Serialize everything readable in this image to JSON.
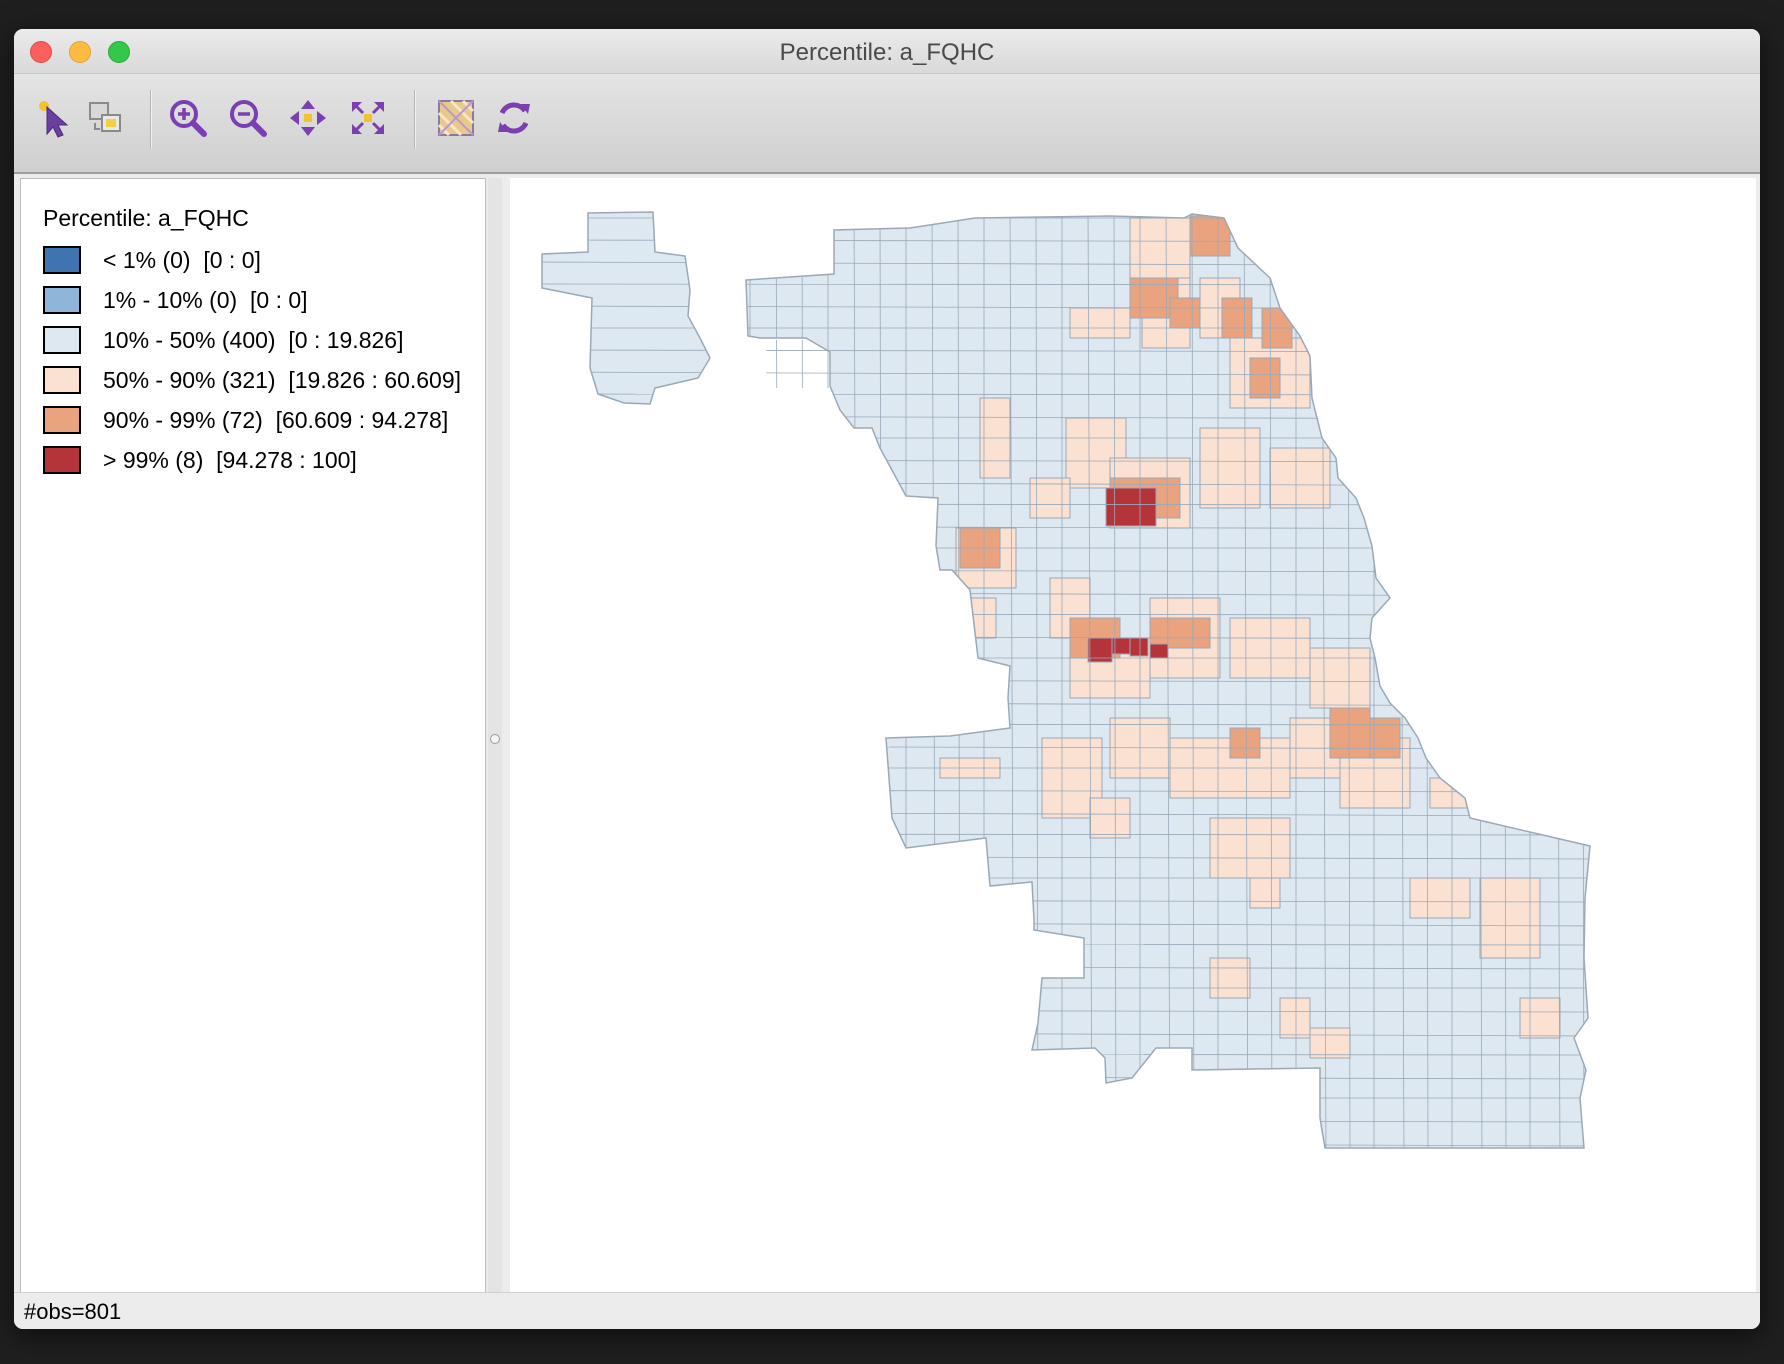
{
  "window": {
    "title": "Percentile: a_FQHC"
  },
  "toolbar": {
    "tools": [
      {
        "name": "select-icon"
      },
      {
        "name": "copy-selection-icon"
      },
      {
        "name": "zoom-in-icon"
      },
      {
        "name": "zoom-out-icon"
      },
      {
        "name": "pan-icon"
      },
      {
        "name": "fit-to-window-icon"
      },
      {
        "name": "map-layers-icon"
      },
      {
        "name": "refresh-icon"
      }
    ]
  },
  "legend": {
    "title": "Percentile: a_FQHC",
    "items": [
      {
        "label": "< 1% (0)  [0 : 0]",
        "color": "#3f74b1"
      },
      {
        "label": "1% - 10% (0)  [0 : 0]",
        "color": "#8fb6d9"
      },
      {
        "label": "10% - 50% (400)  [0 : 19.826]",
        "color": "#dde8f1"
      },
      {
        "label": "50% - 90% (321)  [19.826 : 60.609]",
        "color": "#fae1d1"
      },
      {
        "label": "90% - 99% (72)  [60.609 : 94.278]",
        "color": "#e9a37f"
      },
      {
        "label": "> 99% (8)  [94.278 : 100]",
        "color": "#b5343a"
      }
    ]
  },
  "map": {
    "boundary_color": "#9aa9b8"
  },
  "status": {
    "text": "#obs=801"
  }
}
